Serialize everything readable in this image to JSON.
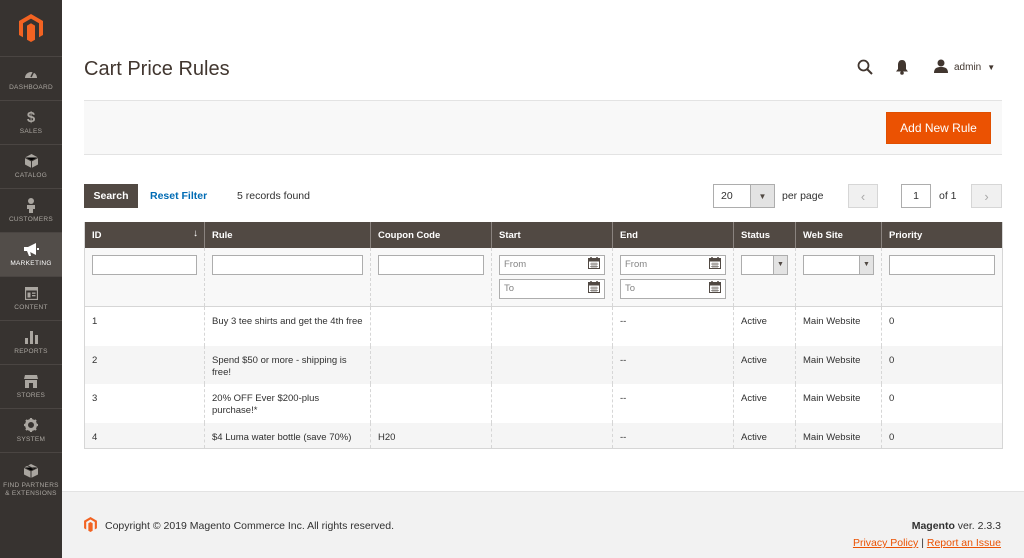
{
  "colors": {
    "sidebar": "#373330",
    "accent": "#eb5202",
    "header": "#514943",
    "link": "#006bb4"
  },
  "sidebar": {
    "items": [
      {
        "label": "DASHBOARD",
        "icon": "dashboard-icon"
      },
      {
        "label": "SALES",
        "icon": "dollar-icon"
      },
      {
        "label": "CATALOG",
        "icon": "cube-icon"
      },
      {
        "label": "CUSTOMERS",
        "icon": "person-icon"
      },
      {
        "label": "MARKETING",
        "icon": "megaphone-icon"
      },
      {
        "label": "CONTENT",
        "icon": "content-icon"
      },
      {
        "label": "REPORTS",
        "icon": "bar-chart-icon"
      },
      {
        "label": "STORES",
        "icon": "store-icon"
      },
      {
        "label": "SYSTEM",
        "icon": "gear-icon"
      },
      {
        "label": "FIND PARTNERS & EXTENSIONS",
        "icon": "extensions-icon"
      }
    ],
    "active": "MARKETING"
  },
  "header": {
    "title": "Cart Price Rules",
    "user": "admin"
  },
  "actions": {
    "add_label": "Add New Rule"
  },
  "grid_controls": {
    "search_label": "Search",
    "reset_label": "Reset Filter",
    "records": "5 records found",
    "per_page_value": "20",
    "per_page_label": "per page",
    "page": "1",
    "of_pages": "of 1"
  },
  "table": {
    "columns": [
      "ID",
      "Rule",
      "Coupon Code",
      "Start",
      "End",
      "Status",
      "Web Site",
      "Priority"
    ],
    "filters": {
      "from": "From",
      "to": "To"
    },
    "rows": [
      {
        "id": "1",
        "rule": "Buy 3 tee shirts and get the 4th free",
        "coupon": "",
        "start": "",
        "end": "--",
        "status": "Active",
        "website": "Main Website",
        "priority": "0"
      },
      {
        "id": "2",
        "rule": "Spend $50 or more - shipping is free!",
        "coupon": "",
        "start": "",
        "end": "--",
        "status": "Active",
        "website": "Main Website",
        "priority": "0"
      },
      {
        "id": "3",
        "rule": "20% OFF Ever $200-plus purchase!*",
        "coupon": "",
        "start": "",
        "end": "--",
        "status": "Active",
        "website": "Main Website",
        "priority": "0"
      },
      {
        "id": "4",
        "rule": "$4 Luma water bottle (save 70%)",
        "coupon": "H20",
        "start": "",
        "end": "--",
        "status": "Active",
        "website": "Main Website",
        "priority": "0"
      }
    ]
  },
  "footer": {
    "copyright": "Copyright © 2019 Magento Commerce Inc. All rights reserved.",
    "brand": "Magento",
    "version": " ver. 2.3.3",
    "privacy": "Privacy Policy",
    "separator": " | ",
    "report": "Report an Issue"
  }
}
